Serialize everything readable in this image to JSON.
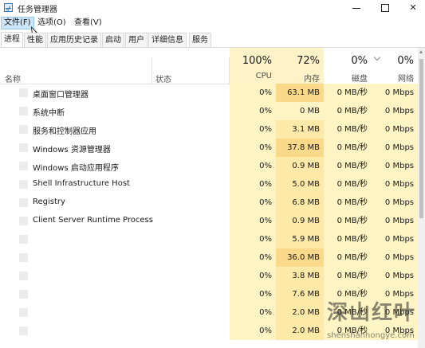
{
  "window": {
    "title": "任务管理器"
  },
  "menu": [
    {
      "label": "文件(F)",
      "active": true
    },
    {
      "label": "选项(O)",
      "active": false
    },
    {
      "label": "查看(V)",
      "active": false
    }
  ],
  "tabs": [
    {
      "label": "进程",
      "active": true
    },
    {
      "label": "性能",
      "active": false
    },
    {
      "label": "应用历史记录",
      "active": false
    },
    {
      "label": "启动",
      "active": false
    },
    {
      "label": "用户",
      "active": false
    },
    {
      "label": "详细信息",
      "active": false
    },
    {
      "label": "服务",
      "active": false
    }
  ],
  "columns": {
    "name": "名称",
    "status": "状态",
    "cpu": {
      "percent": "100%",
      "label": "CPU"
    },
    "memory": {
      "percent": "72%",
      "label": "内存"
    },
    "disk": {
      "percent": "0%",
      "label": "磁盘"
    },
    "network": {
      "percent": "0%",
      "label": "网络"
    }
  },
  "colors": {
    "heat_light": "#fff4c4",
    "heat_mid": "#fde9a8",
    "heat_strong": "#fbd98a",
    "header_heat": "#fdf2c8"
  },
  "processes": [
    {
      "name": "桌面窗口管理器",
      "cpu": "0%",
      "memory": "63.1 MB",
      "disk": "0 MB/秒",
      "network": "0 Mbps",
      "mem_heat": "strong"
    },
    {
      "name": "系统中断",
      "cpu": "0%",
      "memory": "0 MB",
      "disk": "0 MB/秒",
      "network": "0 Mbps",
      "mem_heat": "light"
    },
    {
      "name": "服务和控制器应用",
      "cpu": "0%",
      "memory": "3.1 MB",
      "disk": "0 MB/秒",
      "network": "0 Mbps",
      "mem_heat": "mid"
    },
    {
      "name": "Windows 资源管理器",
      "cpu": "0%",
      "memory": "37.8 MB",
      "disk": "0 MB/秒",
      "network": "0 Mbps",
      "mem_heat": "strong"
    },
    {
      "name": "Windows 启动应用程序",
      "cpu": "0%",
      "memory": "0.9 MB",
      "disk": "0 MB/秒",
      "network": "0 Mbps",
      "mem_heat": "mid"
    },
    {
      "name": "Shell Infrastructure Host",
      "cpu": "0%",
      "memory": "5.0 MB",
      "disk": "0 MB/秒",
      "network": "0 Mbps",
      "mem_heat": "mid"
    },
    {
      "name": "Registry",
      "cpu": "0%",
      "memory": "6.8 MB",
      "disk": "0 MB/秒",
      "network": "0 Mbps",
      "mem_heat": "mid"
    },
    {
      "name": "Client Server Runtime Process",
      "cpu": "0%",
      "memory": "0.9 MB",
      "disk": "0 MB/秒",
      "network": "0 Mbps",
      "mem_heat": "mid"
    },
    {
      "name": "",
      "cpu": "0%",
      "memory": "5.9 MB",
      "disk": "0 MB/秒",
      "network": "0 Mbps",
      "mem_heat": "mid"
    },
    {
      "name": "",
      "cpu": "0%",
      "memory": "36.0 MB",
      "disk": "0 MB/秒",
      "network": "0 Mbps",
      "mem_heat": "strong"
    },
    {
      "name": "",
      "cpu": "0%",
      "memory": "3.8 MB",
      "disk": "0 MB/秒",
      "network": "0 Mbps",
      "mem_heat": "mid"
    },
    {
      "name": "",
      "cpu": "0%",
      "memory": "7.6 MB",
      "disk": "0 MB/秒",
      "network": "0 Mbps",
      "mem_heat": "mid"
    },
    {
      "name": "",
      "cpu": "0%",
      "memory": "2.0 MB",
      "disk": "0 MB/秒",
      "network": "0 Mbps",
      "mem_heat": "mid"
    },
    {
      "name": "",
      "cpu": "0%",
      "memory": "2.0 MB",
      "disk": "0 MB/秒",
      "network": "0 Mbps",
      "mem_heat": "mid"
    }
  ],
  "watermark": {
    "text": "深山红叶",
    "url_text": "shenshanhongye.com"
  }
}
